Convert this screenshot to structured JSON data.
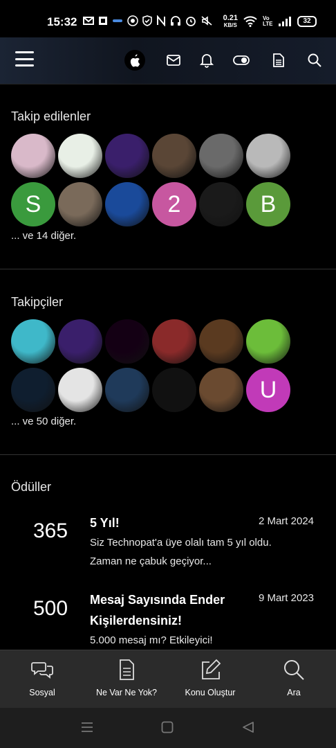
{
  "status_bar": {
    "time": "15:32",
    "net_speed_value": "0.21",
    "net_speed_unit": "KB/S",
    "battery": "32",
    "volte": "Vo LTE"
  },
  "header": {
    "menu_icon": "hamburger-icon",
    "icons": [
      "apple-icon",
      "mail-icon",
      "bell-icon",
      "toggle-icon",
      "document-icon",
      "search-icon"
    ]
  },
  "following": {
    "title": "Takip edilenler",
    "more": "... ve 14 diğer.",
    "avatars": [
      {
        "kind": "image",
        "color": "#d9b9c9"
      },
      {
        "kind": "image",
        "color": "#e8efe6"
      },
      {
        "kind": "image",
        "color": "#3a1f6b"
      },
      {
        "kind": "image",
        "color": "#5a4636"
      },
      {
        "kind": "image",
        "color": "#6a6a6a"
      },
      {
        "kind": "image",
        "color": "#b9b9b9"
      },
      {
        "kind": "letter",
        "letter": "S",
        "color": "#3a9a3d"
      },
      {
        "kind": "image",
        "color": "#7a6a5a"
      },
      {
        "kind": "image",
        "color": "#1a4a9a"
      },
      {
        "kind": "letter",
        "letter": "2",
        "color": "#c757a0"
      },
      {
        "kind": "image",
        "color": "#1a1a1a"
      },
      {
        "kind": "letter",
        "letter": "B",
        "color": "#5a9a3a"
      }
    ]
  },
  "followers": {
    "title": "Takipçiler",
    "more": "... ve 50 diğer.",
    "avatars": [
      {
        "kind": "image",
        "color": "#3fb8c9"
      },
      {
        "kind": "image",
        "color": "#3a1f6b"
      },
      {
        "kind": "image",
        "color": "#140014"
      },
      {
        "kind": "image",
        "color": "#8a2a2a"
      },
      {
        "kind": "image",
        "color": "#5a3a20"
      },
      {
        "kind": "image",
        "color": "#6cbd3a"
      },
      {
        "kind": "image",
        "color": "#0f1e2f"
      },
      {
        "kind": "image",
        "color": "#e4e4e4"
      },
      {
        "kind": "image",
        "color": "#1f3a5a"
      },
      {
        "kind": "image",
        "color": "#111111"
      },
      {
        "kind": "image",
        "color": "#6a4a30"
      },
      {
        "kind": "letter",
        "letter": "U",
        "color": "#c13ab8"
      }
    ]
  },
  "awards": {
    "title": "Ödüller",
    "items": [
      {
        "points": "365",
        "title_lines": [
          "5 Yıl!"
        ],
        "date": "2 Mart 2024",
        "desc_lines": [
          "Siz Technopat'a üye olalı tam 5 yıl oldu.",
          "Zaman ne çabuk geçiyor..."
        ]
      },
      {
        "points": "500",
        "title_lines": [
          "Mesaj Sayısında Ender",
          "Kişilerdensiniz!"
        ],
        "date": "9 Mart 2023",
        "desc_lines": [
          "5.000 mesaj mı? Etkileyici!"
        ]
      }
    ]
  },
  "bottom_nav": {
    "items": [
      {
        "label": "Sosyal",
        "icon": "chat-bubbles-icon"
      },
      {
        "label": "Ne Var Ne Yok?",
        "icon": "document-icon"
      },
      {
        "label": "Konu Oluştur",
        "icon": "edit-icon"
      },
      {
        "label": "Ara",
        "icon": "search-icon"
      }
    ]
  },
  "system_nav": {
    "icons": [
      "recents-icon",
      "home-icon",
      "back-icon"
    ]
  }
}
